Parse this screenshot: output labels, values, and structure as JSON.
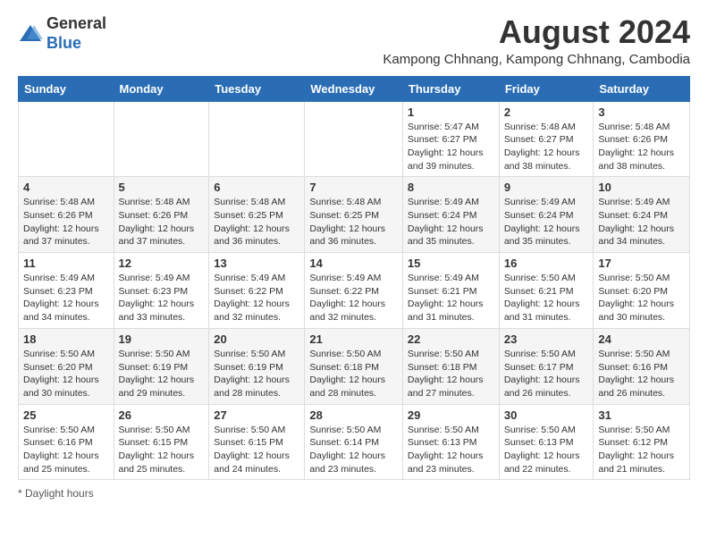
{
  "header": {
    "logo_general": "General",
    "logo_blue": "Blue",
    "month_title": "August 2024",
    "subtitle": "Kampong Chhnang, Kampong Chhnang, Cambodia"
  },
  "weekdays": [
    "Sunday",
    "Monday",
    "Tuesday",
    "Wednesday",
    "Thursday",
    "Friday",
    "Saturday"
  ],
  "weeks": [
    [
      {
        "day": "",
        "info": ""
      },
      {
        "day": "",
        "info": ""
      },
      {
        "day": "",
        "info": ""
      },
      {
        "day": "",
        "info": ""
      },
      {
        "day": "1",
        "info": "Sunrise: 5:47 AM\nSunset: 6:27 PM\nDaylight: 12 hours and 39 minutes."
      },
      {
        "day": "2",
        "info": "Sunrise: 5:48 AM\nSunset: 6:27 PM\nDaylight: 12 hours and 38 minutes."
      },
      {
        "day": "3",
        "info": "Sunrise: 5:48 AM\nSunset: 6:26 PM\nDaylight: 12 hours and 38 minutes."
      }
    ],
    [
      {
        "day": "4",
        "info": "Sunrise: 5:48 AM\nSunset: 6:26 PM\nDaylight: 12 hours and 37 minutes."
      },
      {
        "day": "5",
        "info": "Sunrise: 5:48 AM\nSunset: 6:26 PM\nDaylight: 12 hours and 37 minutes."
      },
      {
        "day": "6",
        "info": "Sunrise: 5:48 AM\nSunset: 6:25 PM\nDaylight: 12 hours and 36 minutes."
      },
      {
        "day": "7",
        "info": "Sunrise: 5:48 AM\nSunset: 6:25 PM\nDaylight: 12 hours and 36 minutes."
      },
      {
        "day": "8",
        "info": "Sunrise: 5:49 AM\nSunset: 6:24 PM\nDaylight: 12 hours and 35 minutes."
      },
      {
        "day": "9",
        "info": "Sunrise: 5:49 AM\nSunset: 6:24 PM\nDaylight: 12 hours and 35 minutes."
      },
      {
        "day": "10",
        "info": "Sunrise: 5:49 AM\nSunset: 6:24 PM\nDaylight: 12 hours and 34 minutes."
      }
    ],
    [
      {
        "day": "11",
        "info": "Sunrise: 5:49 AM\nSunset: 6:23 PM\nDaylight: 12 hours and 34 minutes."
      },
      {
        "day": "12",
        "info": "Sunrise: 5:49 AM\nSunset: 6:23 PM\nDaylight: 12 hours and 33 minutes."
      },
      {
        "day": "13",
        "info": "Sunrise: 5:49 AM\nSunset: 6:22 PM\nDaylight: 12 hours and 32 minutes."
      },
      {
        "day": "14",
        "info": "Sunrise: 5:49 AM\nSunset: 6:22 PM\nDaylight: 12 hours and 32 minutes."
      },
      {
        "day": "15",
        "info": "Sunrise: 5:49 AM\nSunset: 6:21 PM\nDaylight: 12 hours and 31 minutes."
      },
      {
        "day": "16",
        "info": "Sunrise: 5:50 AM\nSunset: 6:21 PM\nDaylight: 12 hours and 31 minutes."
      },
      {
        "day": "17",
        "info": "Sunrise: 5:50 AM\nSunset: 6:20 PM\nDaylight: 12 hours and 30 minutes."
      }
    ],
    [
      {
        "day": "18",
        "info": "Sunrise: 5:50 AM\nSunset: 6:20 PM\nDaylight: 12 hours and 30 minutes."
      },
      {
        "day": "19",
        "info": "Sunrise: 5:50 AM\nSunset: 6:19 PM\nDaylight: 12 hours and 29 minutes."
      },
      {
        "day": "20",
        "info": "Sunrise: 5:50 AM\nSunset: 6:19 PM\nDaylight: 12 hours and 28 minutes."
      },
      {
        "day": "21",
        "info": "Sunrise: 5:50 AM\nSunset: 6:18 PM\nDaylight: 12 hours and 28 minutes."
      },
      {
        "day": "22",
        "info": "Sunrise: 5:50 AM\nSunset: 6:18 PM\nDaylight: 12 hours and 27 minutes."
      },
      {
        "day": "23",
        "info": "Sunrise: 5:50 AM\nSunset: 6:17 PM\nDaylight: 12 hours and 26 minutes."
      },
      {
        "day": "24",
        "info": "Sunrise: 5:50 AM\nSunset: 6:16 PM\nDaylight: 12 hours and 26 minutes."
      }
    ],
    [
      {
        "day": "25",
        "info": "Sunrise: 5:50 AM\nSunset: 6:16 PM\nDaylight: 12 hours and 25 minutes."
      },
      {
        "day": "26",
        "info": "Sunrise: 5:50 AM\nSunset: 6:15 PM\nDaylight: 12 hours and 25 minutes."
      },
      {
        "day": "27",
        "info": "Sunrise: 5:50 AM\nSunset: 6:15 PM\nDaylight: 12 hours and 24 minutes."
      },
      {
        "day": "28",
        "info": "Sunrise: 5:50 AM\nSunset: 6:14 PM\nDaylight: 12 hours and 23 minutes."
      },
      {
        "day": "29",
        "info": "Sunrise: 5:50 AM\nSunset: 6:13 PM\nDaylight: 12 hours and 23 minutes."
      },
      {
        "day": "30",
        "info": "Sunrise: 5:50 AM\nSunset: 6:13 PM\nDaylight: 12 hours and 22 minutes."
      },
      {
        "day": "31",
        "info": "Sunrise: 5:50 AM\nSunset: 6:12 PM\nDaylight: 12 hours and 21 minutes."
      }
    ]
  ],
  "footer": {
    "note": "Daylight hours"
  }
}
